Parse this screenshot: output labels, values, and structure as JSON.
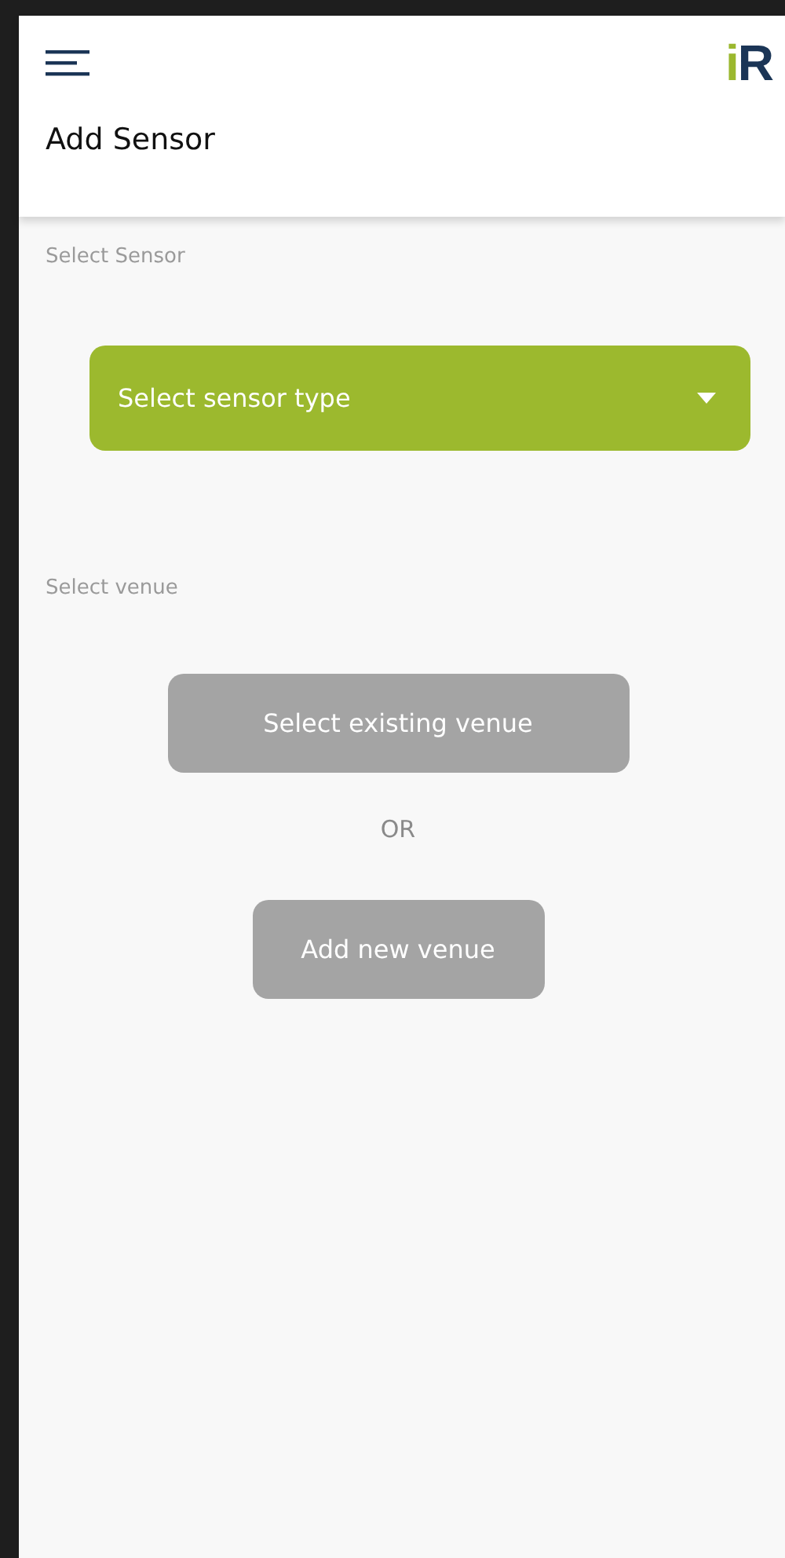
{
  "header": {
    "logo": [
      {
        "text": "i",
        "color": "#9bb82e"
      },
      {
        "text": "R",
        "color": "#1b3556"
      }
    ],
    "title": "Add Sensor"
  },
  "sensor_section": {
    "label": "Select Sensor",
    "dropdown": {
      "placeholder": "Select sensor type",
      "expanded": false
    }
  },
  "venue_section": {
    "label": "Select venue",
    "buttons": [
      {
        "label": "Select existing venue",
        "disabled": true
      },
      {
        "label": "Add new venue",
        "disabled": true
      }
    ],
    "separator": "OR"
  }
}
